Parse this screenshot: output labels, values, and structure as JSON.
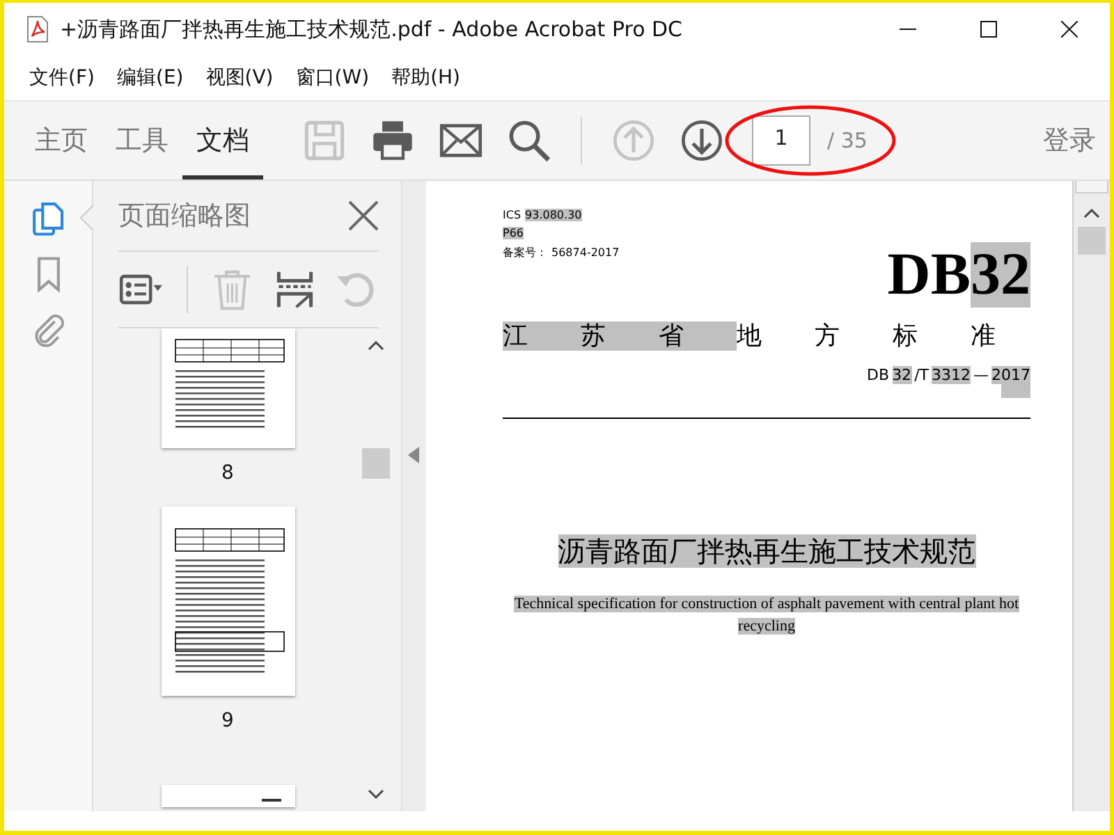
{
  "window": {
    "title": "+沥青路面厂拌热再生施工技术规范.pdf - Adobe Acrobat Pro DC"
  },
  "menu": [
    "文件(F)",
    "编辑(E)",
    "视图(V)",
    "窗口(W)",
    "帮助(H)"
  ],
  "tabs": [
    {
      "label": "主页",
      "selected": false
    },
    {
      "label": "工具",
      "selected": false
    },
    {
      "label": "文档",
      "selected": true
    }
  ],
  "toolbar": {
    "tools": [
      {
        "kind": "save",
        "disabled": true
      },
      {
        "kind": "print",
        "disabled": false
      },
      {
        "kind": "mail",
        "disabled": false
      },
      {
        "kind": "search",
        "disabled": false
      },
      {
        "kind": "divider"
      },
      {
        "kind": "up",
        "disabled": true
      },
      {
        "kind": "down",
        "disabled": false
      }
    ],
    "page_number": "1",
    "page_total": "/ 35",
    "sign_in": "登录"
  },
  "side_rail": [
    {
      "kind": "pages",
      "selected": true
    },
    {
      "kind": "bookmark",
      "selected": false
    },
    {
      "kind": "clip",
      "selected": false
    }
  ],
  "panel": {
    "title": "页面缩略图",
    "tools": [
      {
        "kind": "options",
        "disabled": false
      },
      {
        "kind": "divider"
      },
      {
        "kind": "delete",
        "disabled": true
      },
      {
        "kind": "insert",
        "disabled": false
      },
      {
        "kind": "rotate",
        "disabled": true
      }
    ],
    "thumbnails": [
      {
        "kind": "cut",
        "label": "8"
      },
      {
        "kind": "full",
        "label": "9"
      },
      {
        "kind": "partial"
      }
    ]
  },
  "document": {
    "header_lines": [
      [
        {
          "text": "ICS",
          "highlighted": false
        },
        {
          "text": "93.080.30",
          "highlighted": true
        }
      ],
      [
        {
          "text": "P66",
          "highlighted": true
        }
      ],
      [
        {
          "text": "备案号：",
          "highlighted": false
        },
        {
          "text": "56874-2017",
          "highlighted": false
        }
      ]
    ],
    "code": [
      {
        "text": "DB",
        "highlighted": false
      },
      {
        "text": "32",
        "highlighted": true
      }
    ],
    "issuer": [
      {
        "text": "江苏省",
        "highlighted": true
      },
      {
        "text": "地方标准",
        "highlighted": false
      }
    ],
    "doc_number": [
      {
        "text": "DB",
        "highlighted": false
      },
      {
        "text": "32",
        "highlighted": true
      },
      {
        "text": "/T",
        "highlighted": false
      },
      {
        "text": "3312",
        "highlighted": true
      },
      {
        "text": "—",
        "highlighted": false
      },
      {
        "text": "2017",
        "highlighted": true
      }
    ],
    "title": {
      "text": "沥青路面厂拌热再生施工技术规范",
      "highlighted": true
    },
    "subtitle_lines": [
      {
        "text": "Technical specification for construction of asphalt pavement with central plant hot",
        "highlighted": true
      },
      {
        "text": "recycling",
        "highlighted": true
      }
    ]
  }
}
